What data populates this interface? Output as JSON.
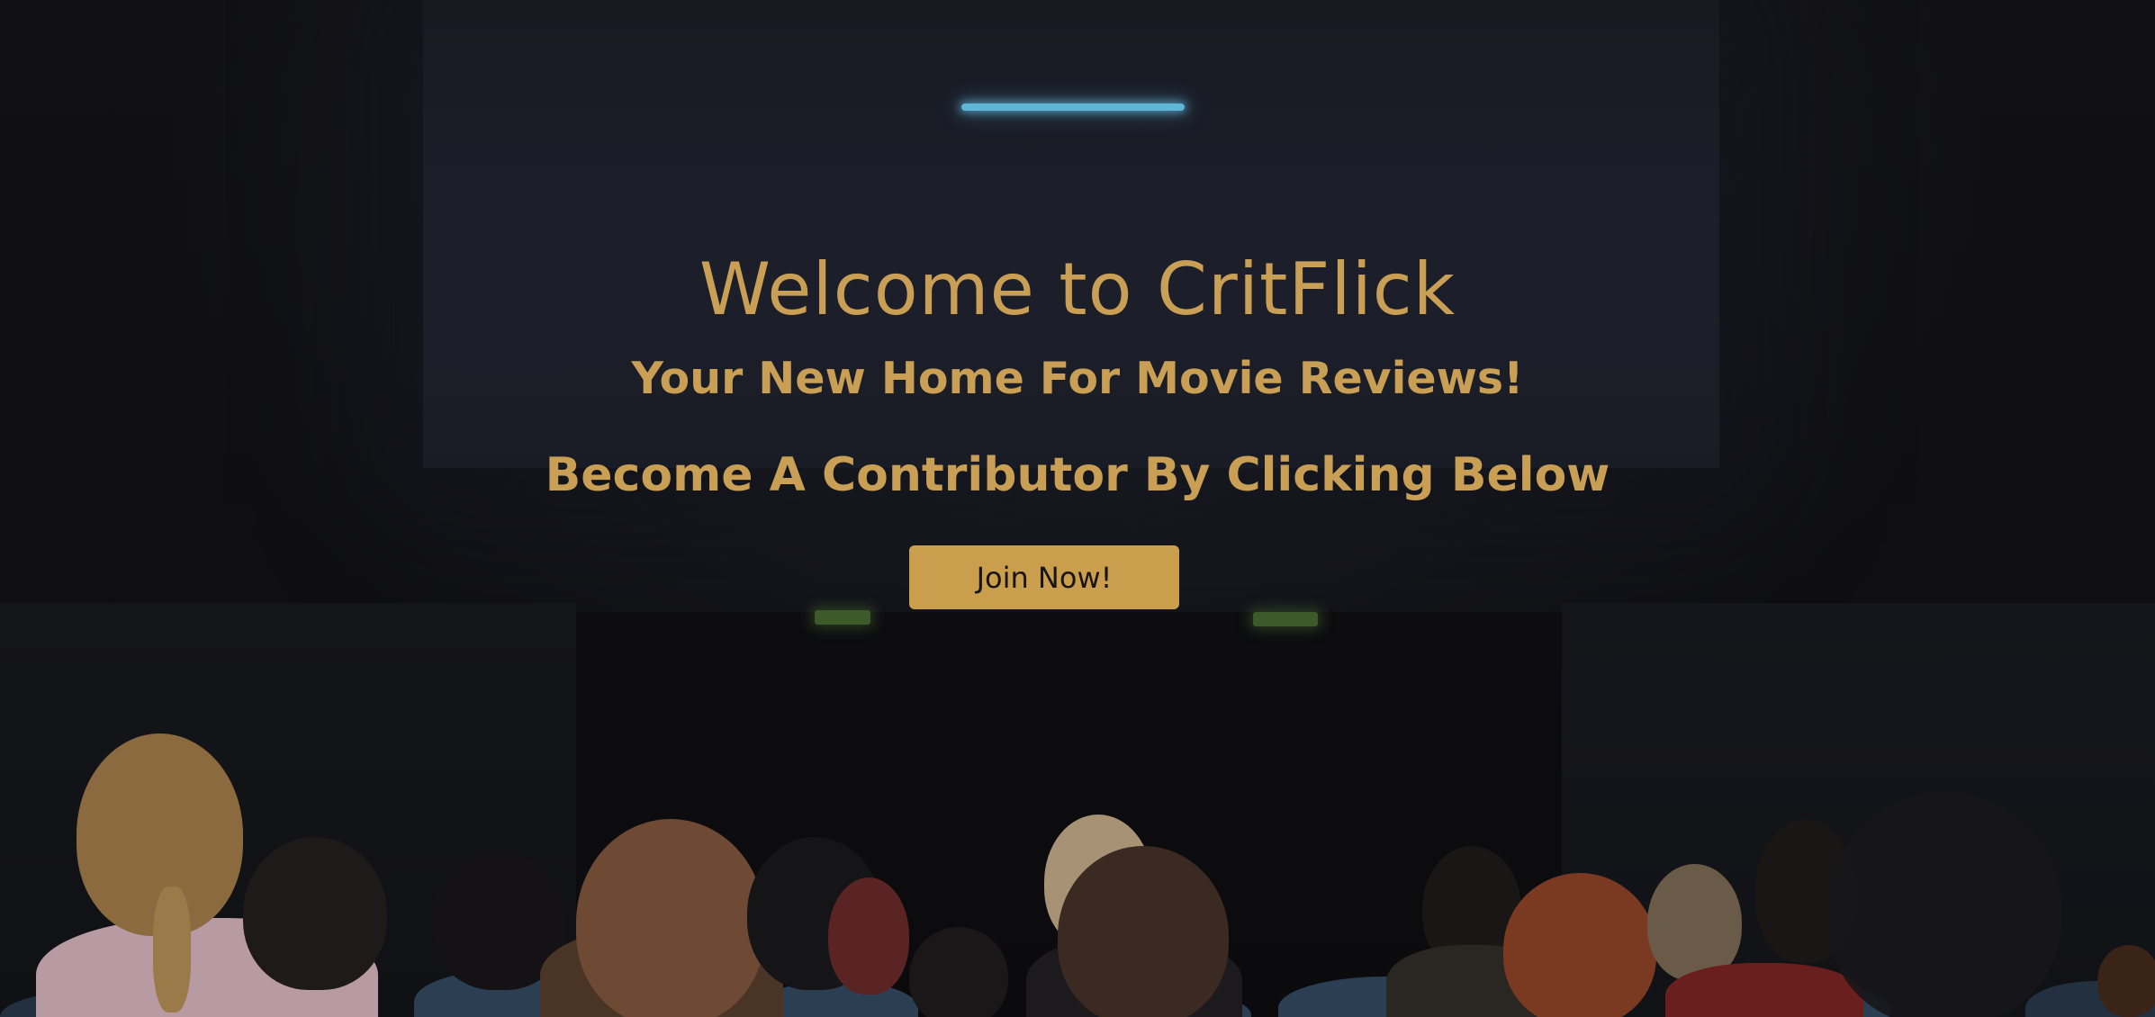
{
  "hero": {
    "title": "Welcome to CritFlick",
    "subtitle": "Your New Home For Movie Reviews!",
    "cta_text": "Become A Contributor By Clicking Below",
    "join_button_label": "Join Now!"
  },
  "colors": {
    "accent": "#c99f55",
    "button_bg": "#c99f4e",
    "button_text": "#1a1410",
    "background": "#0f0f12",
    "projector_light": "#5fb6d8"
  }
}
